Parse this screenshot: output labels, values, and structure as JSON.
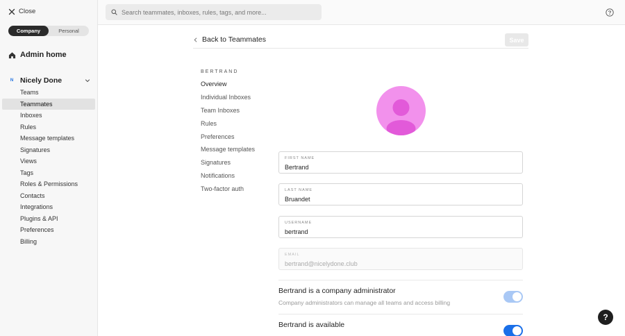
{
  "sidebar": {
    "close_label": "Close",
    "segments": {
      "company": "Company",
      "personal": "Personal"
    },
    "admin_home": "Admin home",
    "org": {
      "badge": "N",
      "name": "Nicely Done"
    },
    "items": [
      {
        "label": "Teams"
      },
      {
        "label": "Teammates"
      },
      {
        "label": "Inboxes"
      },
      {
        "label": "Rules"
      },
      {
        "label": "Message templates"
      },
      {
        "label": "Signatures"
      },
      {
        "label": "Views"
      },
      {
        "label": "Tags"
      },
      {
        "label": "Roles & Permissions"
      },
      {
        "label": "Contacts"
      },
      {
        "label": "Integrations"
      },
      {
        "label": "Plugins & API"
      },
      {
        "label": "Preferences"
      },
      {
        "label": "Billing"
      }
    ],
    "selected_index": 1
  },
  "topbar": {
    "search_placeholder": "Search teammates, inboxes, rules, tags, and more..."
  },
  "header": {
    "back_label": "Back to Teammates",
    "save_label": "Save"
  },
  "subnav": {
    "title": "BERTRAND",
    "items": [
      {
        "label": "Overview"
      },
      {
        "label": "Individual Inboxes"
      },
      {
        "label": "Team Inboxes"
      },
      {
        "label": "Rules"
      },
      {
        "label": "Preferences"
      },
      {
        "label": "Message templates"
      },
      {
        "label": "Signatures"
      },
      {
        "label": "Notifications"
      },
      {
        "label": "Two-factor auth"
      }
    ]
  },
  "form": {
    "first_name": {
      "label": "First name",
      "value": "Bertrand"
    },
    "last_name": {
      "label": "Last name",
      "value": "Bruandet"
    },
    "username": {
      "label": "Username",
      "value": "bertrand"
    },
    "email": {
      "label": "Email",
      "value": "bertrand@nicelydone.club"
    }
  },
  "toggles": {
    "admin": {
      "title": "Bertrand is a company administrator",
      "description": "Company administrators can manage all teams and access billing"
    },
    "available": {
      "title": "Bertrand is available"
    }
  },
  "help_fab": "?",
  "colors": {
    "avatar_bg": "#f291ec",
    "avatar_fg": "#e25ad9",
    "toggle_on": "#1a6fe8",
    "toggle_muted": "#a9c8f5"
  }
}
